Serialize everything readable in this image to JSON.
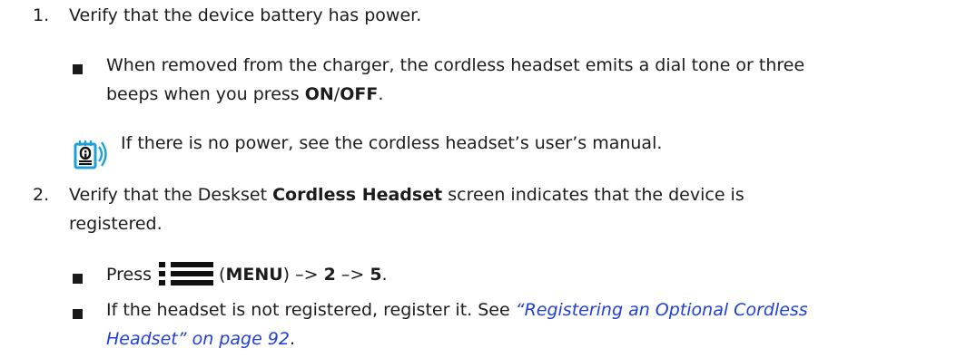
{
  "steps": [
    {
      "number": "1.",
      "text": "Verify that the device battery has power.",
      "bullets": [
        {
          "line1": "When removed from the charger, the cordless headset emits a dial tone or three",
          "line2_pre": "beeps when you press ",
          "line2_bold1": "ON",
          "line2_sep": "/",
          "line2_bold2": "OFF",
          "line2_post": "."
        }
      ],
      "note": {
        "icon": "note-icon",
        "text": "If there is no power, see the cordless headset’s user’s manual."
      }
    },
    {
      "number": "2.",
      "line1_pre": "Verify that the Deskset ",
      "line1_bold": "Cordless Headset",
      "line1_post": " screen indicates that the device is",
      "line2": "registered.",
      "bullets": [
        {
          "pre": "Press",
          "icon": "menu-icon",
          "paren_open": "(",
          "bold": "MENU",
          "paren_close": ")",
          "seq1": " –> ",
          "bold2": "2",
          "seq2": " –> ",
          "bold3": "5",
          "post": "."
        },
        {
          "line1_pre": "If the headset is not registered, register it. See ",
          "link_line1": "“Registering an Optional Cordless",
          "link_line2": "Headset” on page 92",
          "post": "."
        }
      ]
    }
  ],
  "colors": {
    "text": "#1c1c1c",
    "link": "#1f3fd6",
    "note_icon": "#1aa0d8"
  }
}
